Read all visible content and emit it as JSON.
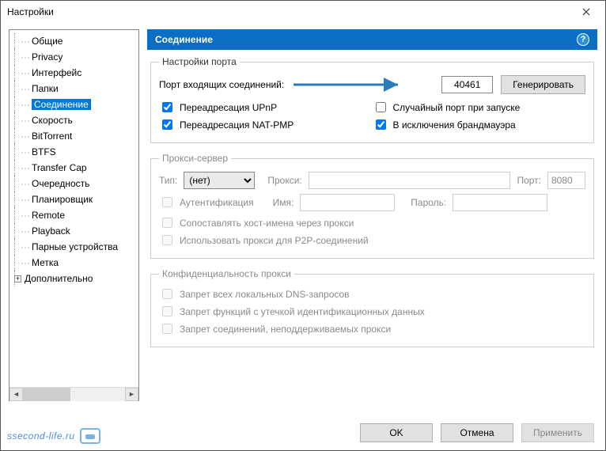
{
  "window": {
    "title": "Настройки"
  },
  "tree": {
    "items": [
      {
        "label": "Общие"
      },
      {
        "label": "Privacy"
      },
      {
        "label": "Интерфейс"
      },
      {
        "label": "Папки"
      },
      {
        "label": "Соединение",
        "selected": true
      },
      {
        "label": "Скорость"
      },
      {
        "label": "BitTorrent"
      },
      {
        "label": "BTFS"
      },
      {
        "label": "Transfer Cap"
      },
      {
        "label": "Очередность"
      },
      {
        "label": "Планировщик"
      },
      {
        "label": "Remote"
      },
      {
        "label": "Playback"
      },
      {
        "label": "Парные устройства"
      },
      {
        "label": "Метка"
      }
    ],
    "extra": {
      "label": "Дополнительно"
    }
  },
  "panel": {
    "header": "Соединение",
    "portGroup": {
      "legend": "Настройки порта",
      "portLabel": "Порт входящих соединений:",
      "portValue": "40461",
      "genBtn": "Генерировать",
      "cbUpnp": "Переадресация UPnP",
      "cbNat": "Переадресация NAT-PMP",
      "cbRandom": "Случайный порт при запуске",
      "cbFirewall": "В исключения брандмауэра"
    },
    "proxyGroup": {
      "legend": "Прокси-сервер",
      "typeLabel": "Тип:",
      "typeValue": "(нет)",
      "proxyLabel": "Прокси:",
      "portLabel": "Порт:",
      "portValue": "8080",
      "cbAuth": "Аутентификация",
      "nameLabel": "Имя:",
      "passLabel": "Пароль:",
      "cbHost": "Сопоставлять хост-имена через прокси",
      "cbP2P": "Использовать прокси для P2P-соединений"
    },
    "privacyGroup": {
      "legend": "Конфиденциальность прокси",
      "cbDns": "Запрет всех локальных DNS-запросов",
      "cbLeak": "Запрет функций с утечкой идентификационных данных",
      "cbUnsup": "Запрет соединений, неподдерживаемых прокси"
    }
  },
  "footer": {
    "ok": "OK",
    "cancel": "Отмена",
    "apply": "Применить"
  },
  "watermark": "ssecond-life.ru"
}
